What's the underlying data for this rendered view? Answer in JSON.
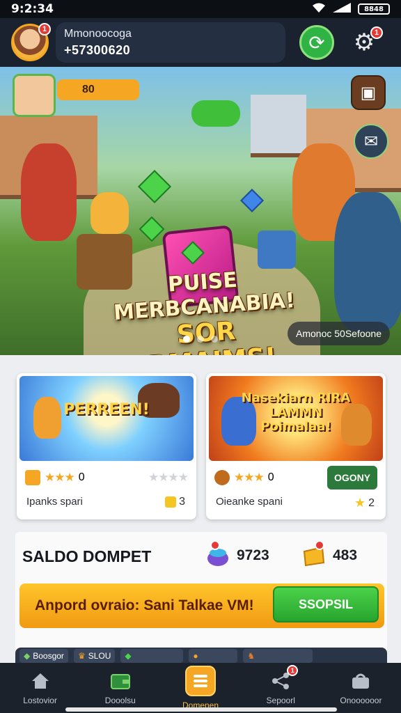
{
  "status": {
    "time": "9:2:34",
    "battery": "8848",
    "icons": [
      "wifi-icon",
      "signal-icon",
      "battery-icon"
    ]
  },
  "header": {
    "username": "Mmonoocoga",
    "balance": "+57300620",
    "avatar_badge": "1",
    "settings_badge": "1"
  },
  "hero": {
    "coins_label": "80",
    "title_line1": "PUISE MERBCANABIA!",
    "title_line2": "SOR IRMAIMS!",
    "tag": "Amonoc 50Sefoone",
    "dots_total": 3,
    "dots_active": 0
  },
  "cards": [
    {
      "thumb_title": "PERREEN!",
      "name": "Ipanks spari",
      "count": "3",
      "rating": 3,
      "rating_text": "0",
      "has_button": false
    },
    {
      "thumb_title": "Nasekiarn RIRA LAMMN Poimalaa!",
      "name": "Oieanke spani",
      "count": "2",
      "rating": 3,
      "rating_text": "0",
      "has_button": true,
      "button_label": "OGONY"
    }
  ],
  "wallet": {
    "title": "SALDO DOMPET",
    "stat1": "9723",
    "stat2": "483",
    "promo_text": "Anpord ovraio: Sani Talkae VM!",
    "deposit_label": "SSOPSIL"
  },
  "strip": {
    "chips": [
      "Boosgor",
      "SLOU"
    ]
  },
  "nav": [
    {
      "label": "Lostovior",
      "icon": "home-icon"
    },
    {
      "label": "Dooolsu",
      "icon": "wallet-icon"
    },
    {
      "label": "Domenen",
      "icon": "menu-icon",
      "active": true
    },
    {
      "label": "Sepoorl",
      "icon": "share-icon",
      "badge": "1"
    },
    {
      "label": "Onoooooor",
      "icon": "shop-icon"
    }
  ],
  "colors": {
    "accent": "#f5a623",
    "green": "#2fb344",
    "dark": "#1a2230"
  }
}
